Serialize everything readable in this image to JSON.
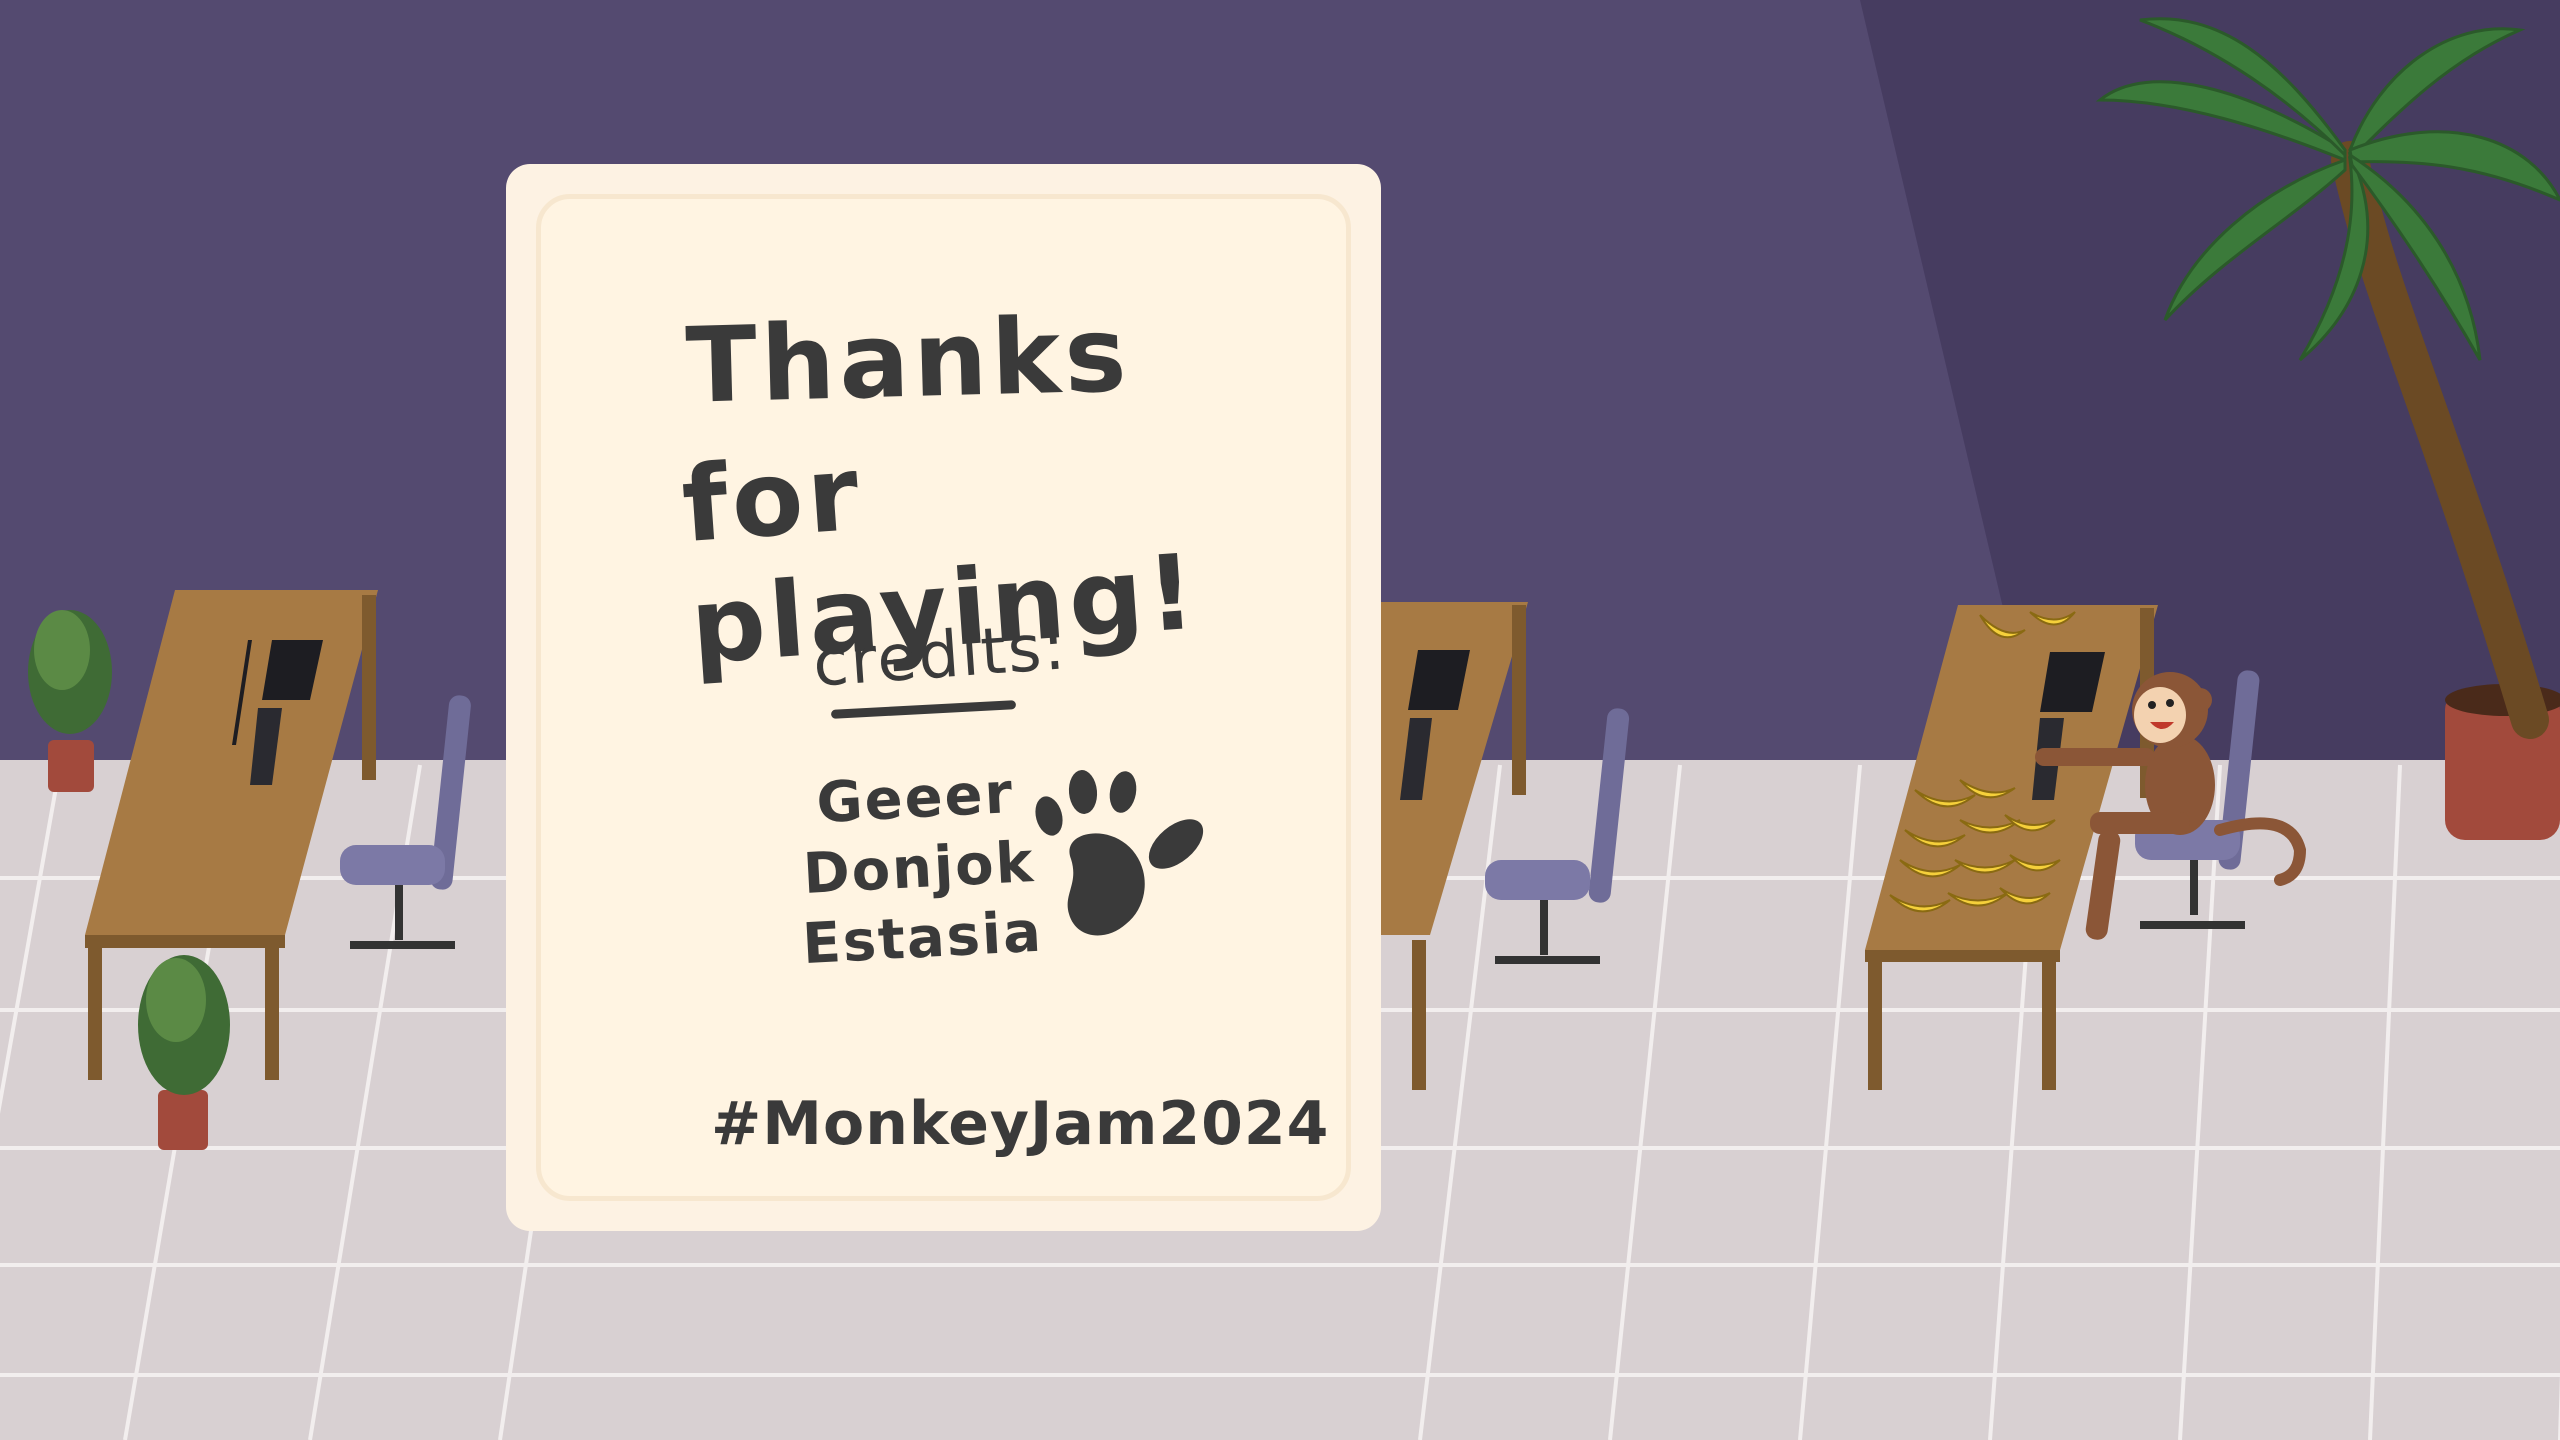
{
  "card": {
    "title_line1": "Thanks",
    "title_line2": "for playing!",
    "credits_heading": "credits:",
    "names": [
      "Geeer",
      "Donjok",
      "Estasia"
    ],
    "hashtag": "#MonkeyJam2024"
  },
  "colors": {
    "wall": "#544a70",
    "wall_shadow": "#463c60",
    "floor": "#d9d2d4",
    "card": "#fff4e2",
    "ink": "#3a3a3a",
    "desk": "#a77a44",
    "chair": "#7c79a6",
    "banana": "#f5d03b",
    "monkey": "#8b5637",
    "palm_leaf": "#3b7a3a"
  },
  "icons": [
    "paw-print-icon"
  ]
}
